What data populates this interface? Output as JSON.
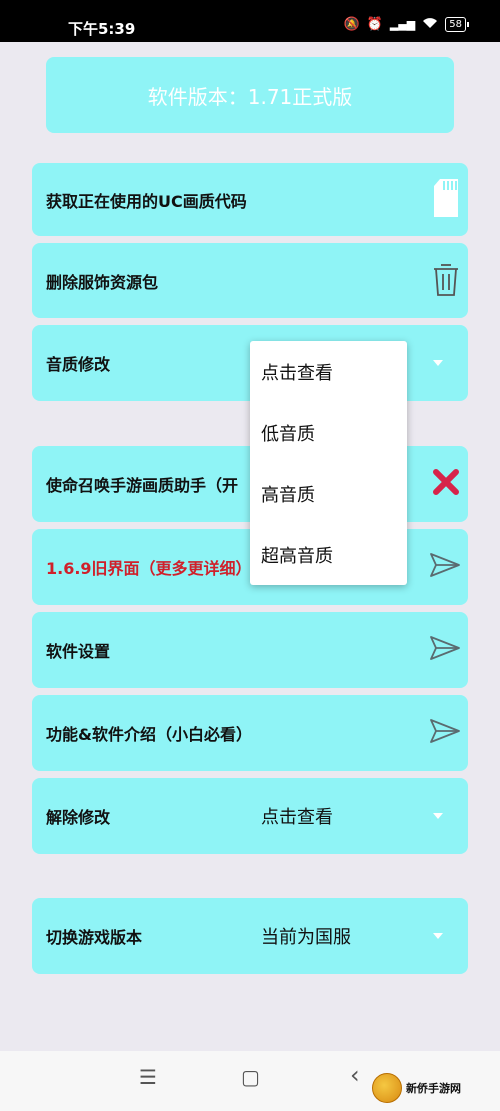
{
  "status_bar": {
    "time": "下午5:39",
    "battery": "58",
    "icons": [
      "mute-icon",
      "alarm-icon",
      "hd-signal-icon",
      "wifi-icon",
      "battery-icon"
    ]
  },
  "version": {
    "text": "软件版本：1.71正式版"
  },
  "cards": {
    "uc_code": {
      "label": "获取正在使用的UC画质代码",
      "icon": "sd-card-icon"
    },
    "delete_pack": {
      "label": "删除服饰资源包",
      "icon": "trash-icon"
    },
    "audio": {
      "label": "音质修改",
      "value": ""
    },
    "cod_helper": {
      "label": "使命召唤手游画质助手（开",
      "icon": "close-x-icon"
    },
    "old_ui": {
      "label": "1.6.9旧界面（更多更详细）",
      "icon": "send-icon"
    },
    "settings": {
      "label": "软件设置",
      "icon": "send-icon"
    },
    "intro": {
      "label": "功能&软件介绍（小白必看）",
      "icon": "send-icon"
    },
    "reset": {
      "label": "解除修改",
      "value": "点击查看"
    },
    "switch_version": {
      "label": "切换游戏版本",
      "value": "当前为国服"
    }
  },
  "dropdown": {
    "items": [
      "点击查看",
      "低音质",
      "高音质",
      "超高音质"
    ]
  },
  "navbar": {
    "menu": "☰",
    "home": "▢",
    "back": "‹"
  },
  "watermark": {
    "text": "新侨手游网"
  },
  "colors": {
    "card_bg": "#8ff4f6",
    "page_bg": "#ebe9f0",
    "warning_red": "#d0202a",
    "close_icon": "#d6234a"
  }
}
